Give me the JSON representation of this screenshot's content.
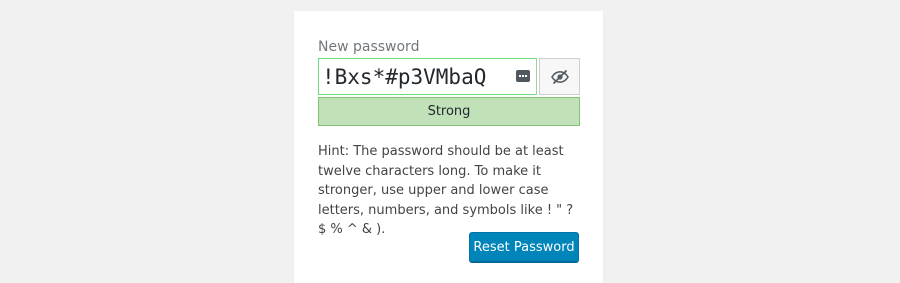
{
  "form": {
    "new_password_label": "New password",
    "password_value": "!Bxs*#p3VMbaQ",
    "strength_text": "Strong",
    "hint_text": "Hint: The password should be at least twelve characters long. To make it stronger, use upper and lower case letters, numbers, and symbols like ! \" ? $ % ^ & ).",
    "reset_button_label": "Reset Password"
  },
  "icons": {
    "keyboard": "keyboard-icon",
    "toggle_visibility": "eye-slash-icon"
  },
  "colors": {
    "background": "#f1f1f1",
    "panel": "#ffffff",
    "strength_bg": "#c1e1b9",
    "strength_border": "#83c373",
    "primary_button": "#0085ba"
  }
}
